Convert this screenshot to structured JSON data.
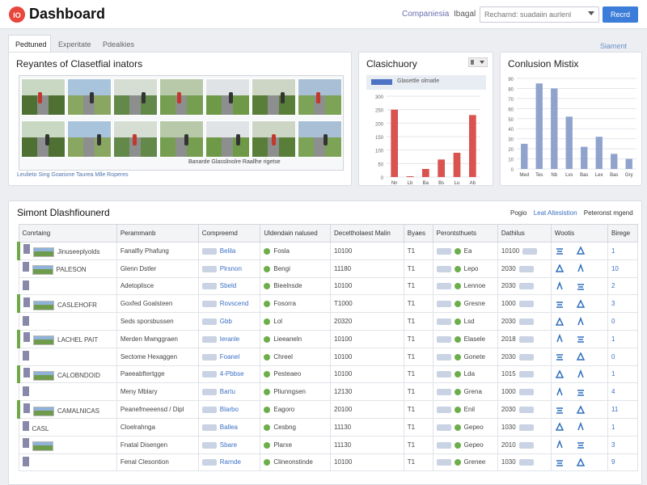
{
  "header": {
    "title": "Dashboard",
    "link1": "Companiesia",
    "link2": "Ibagal",
    "search_placeholder": "Recharnd: suadaiin aurlenl",
    "button": "Recrd"
  },
  "tabs": [
    "Pedtuned",
    "Experitate",
    "Pdealkies"
  ],
  "top_right_link": "Siament tuness",
  "gallery": {
    "title": "Reyantes of Clasetfial inators",
    "caption_left": "Leulieto Sing Goarione Taurea   Mlle Roperes",
    "caption_right": "Banarde Glasslinolre Raallhe rigetse"
  },
  "classification": {
    "title": "Clasichuory",
    "legend": "Glasettle olmatle",
    "bar_color": "#d9534f"
  },
  "confusion": {
    "title": "Conlusion Mistix",
    "bar_color": "#8fa3cc"
  },
  "table": {
    "title": "Simont Dlashfiounerd",
    "pager": [
      "Pogio",
      "Leat Alteslstion",
      "Peteronst mgend"
    ],
    "columns": [
      "Conrtaing",
      "Perammanb",
      "Compreemd",
      "Uldendain nalused",
      "Deceltholaest Malin",
      "Byaes",
      "Perontsthuets",
      "Dathilus",
      "Wootis",
      "Birege"
    ],
    "rows": [
      {
        "c0": "Jinuseeplyolds",
        "c1": "Fanalfiy Phafung",
        "c2": "Belila",
        "c3": "Fosla",
        "c4": "10100",
        "c5": "T1",
        "c6": "Ea",
        "c7": "10100",
        "c9": "1",
        "grp": true
      },
      {
        "c0": "PALESON",
        "c1": "Glenn Dstler",
        "c2": "Plrsnon",
        "c3": "Bengi",
        "c4": "11180",
        "c5": "T1",
        "c6": "Lepo",
        "c7": "2030",
        "c9": "10",
        "grp": false
      },
      {
        "c0": "",
        "c1": "Adetoplisce",
        "c2": "Sbeld",
        "c3": "Bieelnsde",
        "c4": "10100",
        "c5": "T1",
        "c6": "Lennoe",
        "c7": "2030",
        "c9": "2",
        "grp": false
      },
      {
        "c0": "CASLEHOFR",
        "c1": "Goxfed Goalsteen",
        "c2": "Rovscend",
        "c3": "Fosorra",
        "c4": "T1000",
        "c5": "T1",
        "c6": "Gresne",
        "c7": "1000",
        "c9": "3",
        "grp": true
      },
      {
        "c0": "",
        "c1": "Seds sporsbussen",
        "c2": "Gbb",
        "c3": "Lol",
        "c4": "20320",
        "c5": "T1",
        "c6": "Lsd",
        "c7": "2030",
        "c9": "0",
        "grp": false
      },
      {
        "c0": "LACHEL PAIT",
        "c1": "Merden Mwnggraen",
        "c2": "Ieranle",
        "c3": "Lieeaneln",
        "c4": "10100",
        "c5": "T1",
        "c6": "Elasele",
        "c7": "2018",
        "c9": "1",
        "grp": true
      },
      {
        "c0": "",
        "c1": "Sectome Hexaggen",
        "c2": "Foanel",
        "c3": "Chreel",
        "c4": "10100",
        "c5": "T1",
        "c6": "Gonete",
        "c7": "2030",
        "c9": "0",
        "grp": false
      },
      {
        "c0": "CALOBNDOID",
        "c1": "Paeeabftertgge",
        "c2": "4-Pbbse",
        "c3": "Pesteaeo",
        "c4": "10100",
        "c5": "T1",
        "c6": "Lda",
        "c7": "1015",
        "c9": "1",
        "grp": true
      },
      {
        "c0": "",
        "c1": "Meny Mblary",
        "c2": "Bartu",
        "c3": "Pliunngsen",
        "c4": "12130",
        "c5": "T1",
        "c6": "Grena",
        "c7": "1000",
        "c9": "4",
        "grp": false
      },
      {
        "c0": "CAMALNICAS",
        "c1": "Peanefmeeensd / Dipl",
        "c2": "Blarbo",
        "c3": "Eagoro",
        "c4": "20100",
        "c5": "T1",
        "c6": "Enil",
        "c7": "2030",
        "c9": "11",
        "grp": true
      },
      {
        "c0": "CASL",
        "c1": "Cloelrahnga",
        "c2": "Ballea",
        "c3": "Cesbng",
        "c4": "11130",
        "c5": "T1",
        "c6": "Gepeo",
        "c7": "1030",
        "c9": "1",
        "grp": false
      },
      {
        "c0": "",
        "c1": "Fnatal Disengen",
        "c2": "Sbare",
        "c3": "Plarxe",
        "c4": "11130",
        "c5": "T1",
        "c6": "Gepeo",
        "c7": "2010",
        "c9": "3",
        "grp": false
      },
      {
        "c0": "",
        "c1": "Fenal Clesontion",
        "c2": "Rarnde",
        "c3": "Clineonstinde",
        "c4": "10100",
        "c5": "T1",
        "c6": "Grenee",
        "c7": "1030",
        "c9": "9",
        "grp": false
      }
    ]
  },
  "chart_data": [
    {
      "type": "bar",
      "title": "Clasichuory",
      "categories": [
        "Nn",
        "Lb",
        "Ba",
        "Bs",
        "Lu",
        "Ab"
      ],
      "values": [
        250,
        3,
        30,
        65,
        90,
        230
      ],
      "yticks": [
        300,
        250,
        200,
        150,
        100,
        50,
        0
      ],
      "ylim": [
        0,
        300
      ],
      "grid": true
    },
    {
      "type": "bar",
      "title": "Conlusion Mistix",
      "categories": [
        "Med",
        "Tes",
        "Nb",
        "Lvs",
        "Bas",
        "Lex",
        "Bas",
        "Gry"
      ],
      "values": [
        25,
        85,
        80,
        52,
        22,
        32,
        15,
        10
      ],
      "yticks": [
        90,
        80,
        70,
        60,
        50,
        40,
        30,
        20,
        10,
        0
      ],
      "ylim": [
        0,
        90
      ],
      "grid": true
    }
  ]
}
